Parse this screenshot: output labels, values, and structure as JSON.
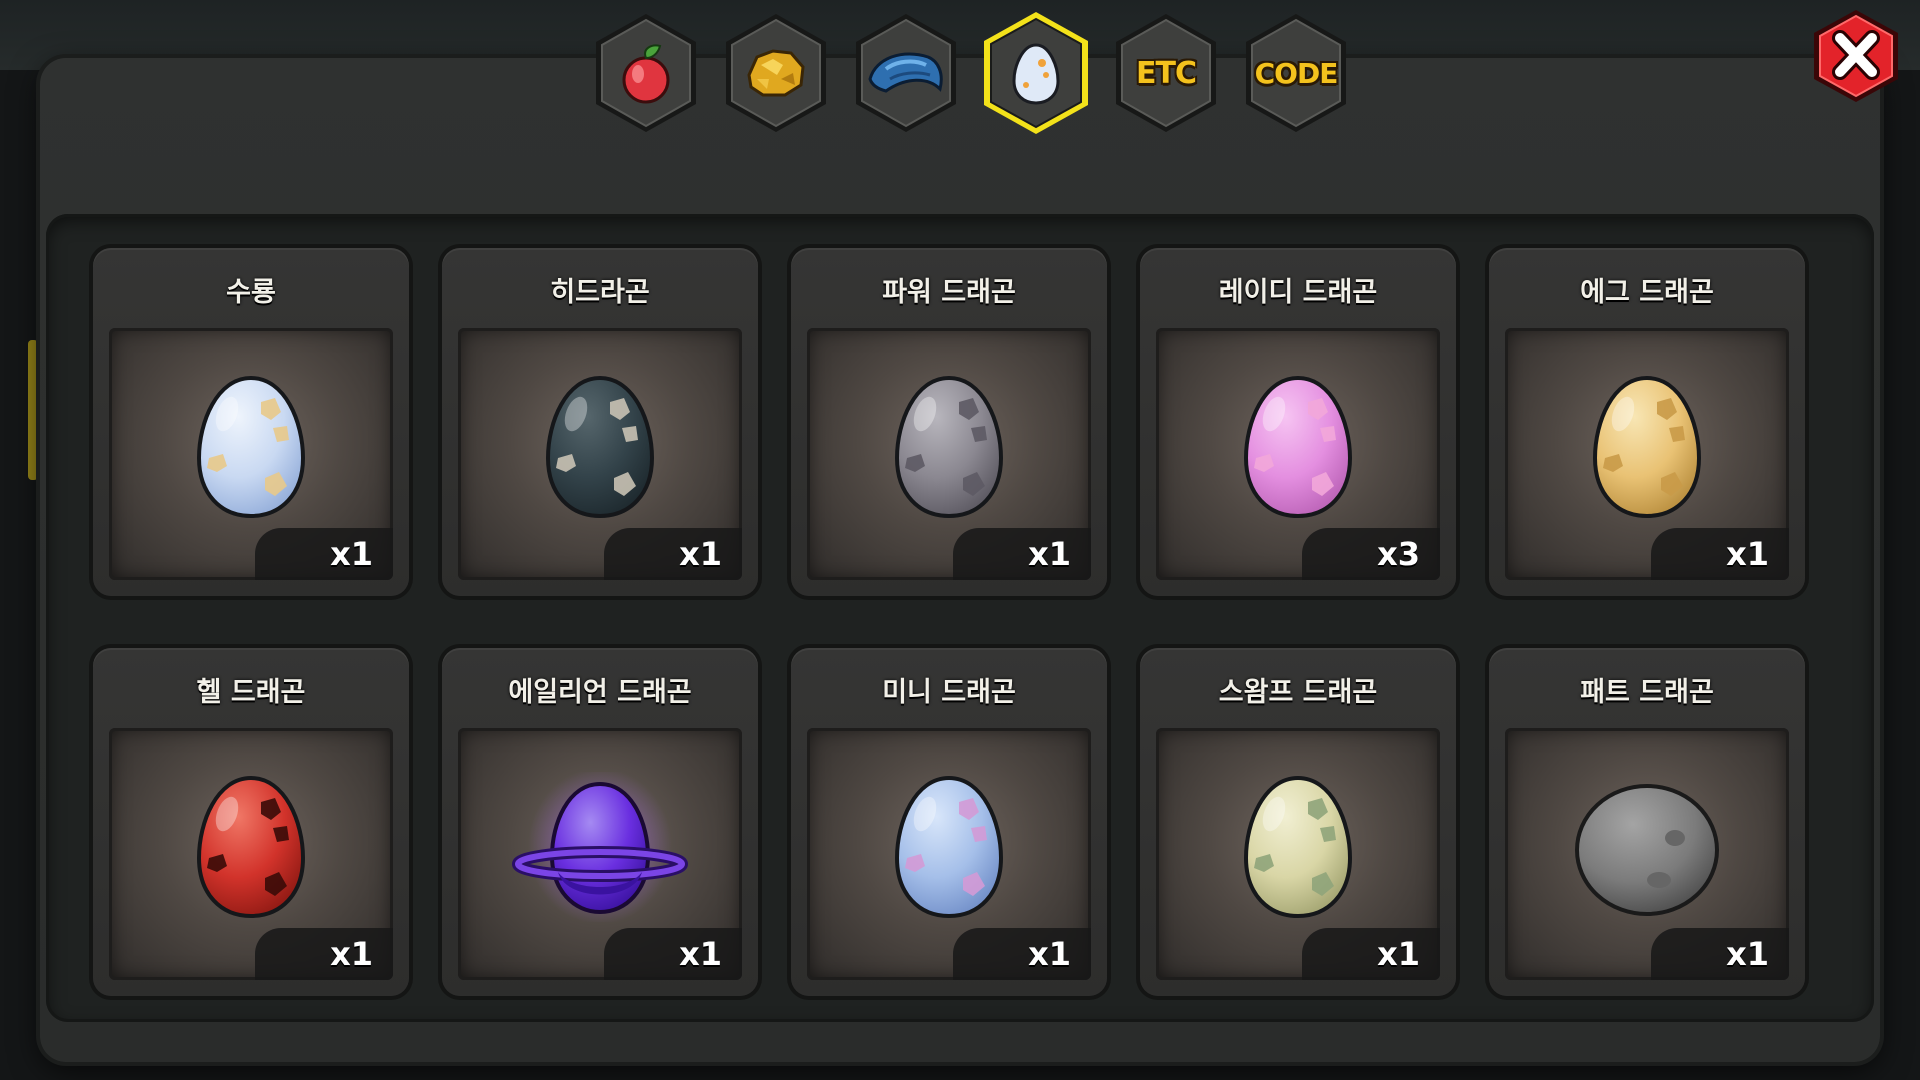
{
  "tabs": [
    {
      "name": "fruit",
      "icon": "red-fruit-icon",
      "label": ""
    },
    {
      "name": "gold",
      "icon": "gold-nugget-icon",
      "label": ""
    },
    {
      "name": "scale",
      "icon": "blue-scale-icon",
      "label": ""
    },
    {
      "name": "egg",
      "icon": "egg-icon",
      "label": "",
      "selected": true
    },
    {
      "name": "etc",
      "icon": "",
      "label": "ETC"
    },
    {
      "name": "code",
      "icon": "",
      "label": "CODE"
    }
  ],
  "close_icon": "close-icon",
  "colors": {
    "tab_selected_border": "#f3e21a",
    "tab_text": "#f4c21d",
    "close_red": "#e3232a"
  },
  "eggs": [
    {
      "name": "수룡",
      "count": "x1",
      "base": "#c9d9f2",
      "light": "#eef4fc",
      "dark": "#8faad8",
      "spot": "#e8c98a"
    },
    {
      "name": "히드라곤",
      "count": "x1",
      "base": "#33434a",
      "light": "#56666c",
      "dark": "#1c272c",
      "spot": "#c9c2b4"
    },
    {
      "name": "파워 드래곤",
      "count": "x1",
      "base": "#8b8891",
      "light": "#b8b6bd",
      "dark": "#58555e",
      "spot": "#5d5a64"
    },
    {
      "name": "레이디 드래곤",
      "count": "x3",
      "base": "#e48fe0",
      "light": "#f6c4f2",
      "dark": "#b85fb4",
      "spot": "#f2a7d9"
    },
    {
      "name": "에그 드래곤",
      "count": "x1",
      "base": "#e9c274",
      "light": "#f8e6b4",
      "dark": "#b58a3a",
      "spot": "#c99a48"
    },
    {
      "name": "헬 드래곤",
      "count": "x1",
      "base": "#d2332b",
      "light": "#f07766",
      "dark": "#8b1812",
      "spot": "#3a0b08"
    },
    {
      "name": "에일리언 드래곤",
      "count": "x1",
      "base": "#6a2fe0",
      "light": "#a58af2",
      "dark": "#3a12a0",
      "spot": "#8c5af2",
      "ring": true
    },
    {
      "name": "미니 드래곤",
      "count": "x1",
      "base": "#a5bfe9",
      "light": "#d8e6fa",
      "dark": "#6d8bc6",
      "spot": "#d39ad6"
    },
    {
      "name": "스왐프 드래곤",
      "count": "x1",
      "base": "#d9d6a6",
      "light": "#f1efd2",
      "dark": "#9ea06d",
      "spot": "#8fa47a"
    },
    {
      "name": "패트 드래곤",
      "count": "x1",
      "base": "#7b7b7b",
      "light": "#a4a4a4",
      "dark": "#4b4b4b",
      "spot": "#666666",
      "fat": true
    }
  ]
}
